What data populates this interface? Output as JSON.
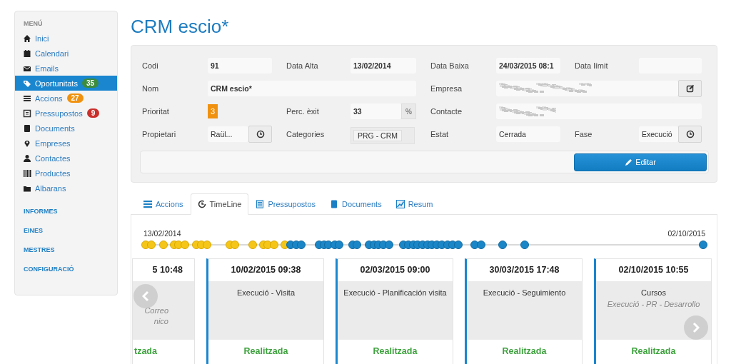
{
  "sidebar": {
    "heading": "MENÚ",
    "items": [
      {
        "label": "Inici",
        "selected": false
      },
      {
        "label": "Calendari",
        "selected": false
      },
      {
        "label": "Emails",
        "selected": false
      },
      {
        "label": "Oportunitats",
        "selected": true,
        "badge": "35",
        "color": "#3d8b3d"
      },
      {
        "label": "Accions",
        "selected": false,
        "badge": "27",
        "color": "#f0920f"
      },
      {
        "label": "Pressupostos",
        "selected": false,
        "badge": "9",
        "color": "#c9302c"
      },
      {
        "label": "Documents",
        "selected": false
      },
      {
        "label": "Empreses",
        "selected": false
      },
      {
        "label": "Contactes",
        "selected": false
      },
      {
        "label": "Productes",
        "selected": false
      },
      {
        "label": "Albarans",
        "selected": false
      }
    ],
    "sections": [
      "INFORMES",
      "EINES",
      "MESTRES",
      "CONFIGURACIÓ"
    ]
  },
  "page_title": "CRM escio*",
  "form": {
    "left_rows": [
      [
        {
          "label": "Codi",
          "value": "91",
          "kind": "bold"
        },
        {
          "label": "Data Alta",
          "value": "13/02/2014",
          "kind": "bold"
        }
      ],
      [
        {
          "label": "Nom",
          "value": "CRM escio*",
          "kind": "wide-bold"
        }
      ],
      [
        {
          "label": "Prioritat",
          "value": "3",
          "kind": "priority"
        },
        {
          "label": "Perc. èxit",
          "value": "33",
          "addon": "%",
          "kind": "addon"
        }
      ],
      [
        {
          "label": "Propietari",
          "value": "Raül...",
          "kind": "select-button"
        },
        {
          "label": "Categories",
          "value": "PRG - CRM",
          "kind": "tag"
        }
      ]
    ],
    "right_rows": [
      [
        {
          "label": "Data Baixa",
          "value": "24/03/2015 08:1",
          "kind": "bold"
        },
        {
          "label": "Data límit",
          "kind": "empty"
        }
      ],
      [
        {
          "label": "Empresa",
          "kind": "wide-redacted-button"
        }
      ],
      [
        {
          "label": "Contacte",
          "kind": "wide-redacted"
        }
      ],
      [
        {
          "label": "Estat",
          "value": "Cerrada",
          "kind": "plain"
        },
        {
          "label": "Fase",
          "value": "Execució",
          "kind": "select-button"
        }
      ]
    ],
    "edit_button": "Editar"
  },
  "tabs": [
    {
      "label": "Accions",
      "selected": false
    },
    {
      "label": "TimeLine",
      "selected": true
    },
    {
      "label": "Pressupostos",
      "selected": false
    },
    {
      "label": "Documents",
      "selected": false
    },
    {
      "label": "Resum",
      "selected": false
    }
  ],
  "timeline": {
    "start_label": "13/02/2014",
    "end_label": "02/10/2015"
  },
  "cards": [
    {
      "kind": "partial",
      "time": "5 10:48",
      "lines": [
        "Correo",
        "nico"
      ],
      "status": "tzada"
    },
    {
      "kind": "full",
      "time": "10/02/2015 09:38",
      "title": "Execució - Visita",
      "status": "Realitzada"
    },
    {
      "kind": "full",
      "time": "02/03/2015 09:00",
      "title": "Execució - Planificación visita",
      "status": "Realitzada"
    },
    {
      "kind": "full",
      "time": "30/03/2015 17:48",
      "title": "Execució - Seguimiento",
      "status": "Realitzada"
    },
    {
      "kind": "full",
      "time": "02/10/2015 10:55",
      "title": "Cursos",
      "subtitle": "Execució - PR - Desarrollo",
      "status": "Realitzada"
    }
  ]
}
